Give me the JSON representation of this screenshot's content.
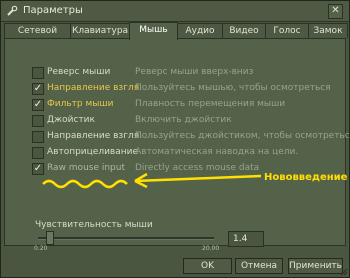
{
  "window": {
    "title": "Параметры",
    "close": "✕"
  },
  "tabs": [
    "Сетевой режим",
    "Клавиатура",
    "Мышь",
    "Аудио",
    "Видео",
    "Голос",
    "Замок"
  ],
  "options": [
    {
      "label": "Реверс мыши",
      "desc": "Реверс мыши вверх-вниз",
      "checked": false,
      "style": "normal"
    },
    {
      "label": "Направление взгля.",
      "desc": "Пользуйтесь мышью, чтобы осмотреться",
      "checked": true,
      "style": "hl"
    },
    {
      "label": "Фильтр мыши",
      "desc": "Плавность перемещения мыши",
      "checked": true,
      "style": "hl"
    },
    {
      "label": "Джойстик",
      "desc": "Включить джойстик",
      "checked": false,
      "style": "normal"
    },
    {
      "label": "Направление взгля.",
      "desc": "Пользуйтесь джойстиком, чтобы осмотреться",
      "checked": false,
      "style": "normal"
    },
    {
      "label": "Автоприцеливание",
      "desc": "Автоматическая наводка на цели.",
      "checked": false,
      "style": "normal"
    },
    {
      "label": "Raw mouse input",
      "desc": "Directly access mouse data",
      "checked": true,
      "style": "dim"
    }
  ],
  "sensitivity": {
    "label": "Чувствительность мыши",
    "min": "0.20",
    "max": "20.00",
    "value": "1.4",
    "level": 0.06
  },
  "annotation": "Нововведение",
  "buttons": {
    "ok": "OK",
    "cancel": "Отмена",
    "apply": "Применить"
  },
  "colors": {
    "highlight": "#e6c84a",
    "annotation": "#ffe000",
    "panel": "#55624a"
  }
}
